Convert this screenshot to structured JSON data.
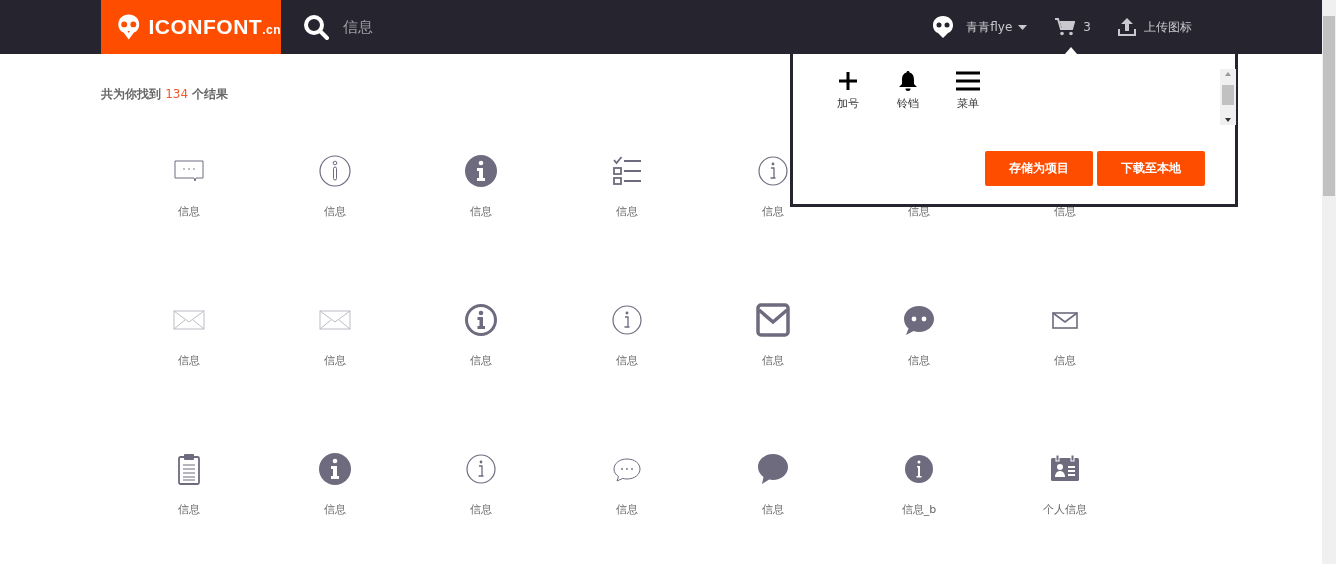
{
  "header": {
    "logo": {
      "name": "ICONFONT",
      "suffix": ".cn"
    },
    "search": {
      "value": "信息"
    },
    "user": {
      "name": "青青flye"
    },
    "cart": {
      "count": "3"
    },
    "upload": {
      "label": "上传图标"
    }
  },
  "results": {
    "prefix": "共为你找到",
    "count": "134",
    "suffix": "个结果"
  },
  "icons": [
    {
      "kind": "chat-box",
      "label": "信息"
    },
    {
      "kind": "info-thin",
      "label": "信息"
    },
    {
      "kind": "info-filled",
      "label": "信息"
    },
    {
      "kind": "checklist",
      "label": "信息"
    },
    {
      "kind": "info-outline",
      "label": "信息"
    },
    {
      "label": "信息"
    },
    {
      "label": "信息"
    },
    {
      "kind": "envelope-light",
      "label": "信息"
    },
    {
      "kind": "envelope-light",
      "label": "信息"
    },
    {
      "kind": "info-bold",
      "label": "信息"
    },
    {
      "kind": "info-outline",
      "label": "信息"
    },
    {
      "kind": "mail-square",
      "label": "信息"
    },
    {
      "kind": "chat-dots-filled",
      "label": "信息"
    },
    {
      "kind": "envelope",
      "label": "信息"
    },
    {
      "kind": "clipboard",
      "label": "信息"
    },
    {
      "kind": "info-filled",
      "label": "信息"
    },
    {
      "kind": "info-outline",
      "label": "信息"
    },
    {
      "kind": "chat-dots",
      "label": "信息"
    },
    {
      "kind": "chat-filled",
      "label": "信息"
    },
    {
      "kind": "info-filled-small",
      "label": "信息_b"
    },
    {
      "kind": "id-card",
      "label": "个人信息"
    }
  ],
  "cart_popup": {
    "items": [
      {
        "kind": "plus",
        "label": "加号"
      },
      {
        "kind": "bell",
        "label": "铃铛"
      },
      {
        "kind": "menu",
        "label": "菜单"
      }
    ],
    "buttons": [
      "存储为项目",
      "下载至本地"
    ]
  }
}
